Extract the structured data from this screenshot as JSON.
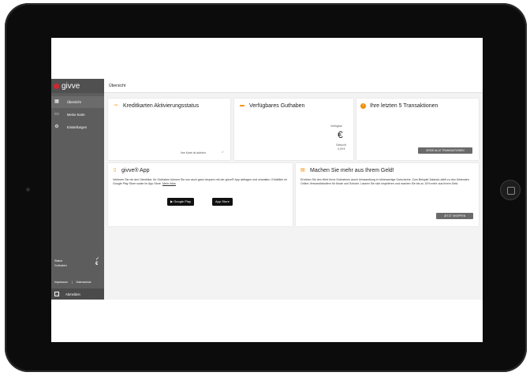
{
  "sidebar": {
    "logo": "givve",
    "items": [
      {
        "icon": "grid-icon",
        "label": "Übersicht"
      },
      {
        "icon": "card-icon",
        "label": "Meine Karte"
      },
      {
        "icon": "gear-icon",
        "label": "Einstellungen"
      }
    ],
    "balance_label": "Status\nGuthaben",
    "footer_links": [
      "Impressum",
      "Datenschutz"
    ],
    "logout_label": "Abmelden"
  },
  "main": {
    "title": "Übersicht"
  },
  "cards": {
    "activation": {
      "title": "Kreditkarten Aktivierungsstatus",
      "icon": "key-icon",
      "status": "Ihre Karte ist aktiviert"
    },
    "balance": {
      "title": "Verfügbares Guthaben",
      "icon": "wallet-icon",
      "label": "Verfügbar",
      "currency": "€",
      "booked_label": "Gebucht",
      "booked_value": "0,00 €"
    },
    "transactions": {
      "title": "Ihre letzten 5 Transaktionen",
      "icon": "info-icon",
      "button": "ZEIGE ALLE TRANSAKTIONEN"
    },
    "app": {
      "title": "givve® App",
      "icon": "phone-icon",
      "text": "Verlieren Sie nie den Überblick: Ihr Guthaben können Sie nun auch ganz bequem mit der givve® App abfragen und verwalten. Erhältlich im Google Play Store sowie im App Store.",
      "link": "Mehr Infos",
      "google_play": "Google Play",
      "app_store": "App Store"
    },
    "promo": {
      "title": "Machen Sie mehr aus Ihrem Geld!",
      "icon": "gift-icon",
      "text": "Erhöhen Sie den Wert Ihres Guthabens durch Umwandlung in höherwertige Gutscheine. Zum Beispiel Zalando zählt zu den führenden Online-Versandhändlern für Mode und Schuhe. Lassen Sie sich inspirieren und machen Sie bis zu 10% mehr aus Ihrem Geld.",
      "button": "JETZT SHOPPEN"
    }
  },
  "colors": {
    "accent": "#f28c00",
    "sidebar": "#5d5d5d",
    "brand": "#d2262f"
  }
}
